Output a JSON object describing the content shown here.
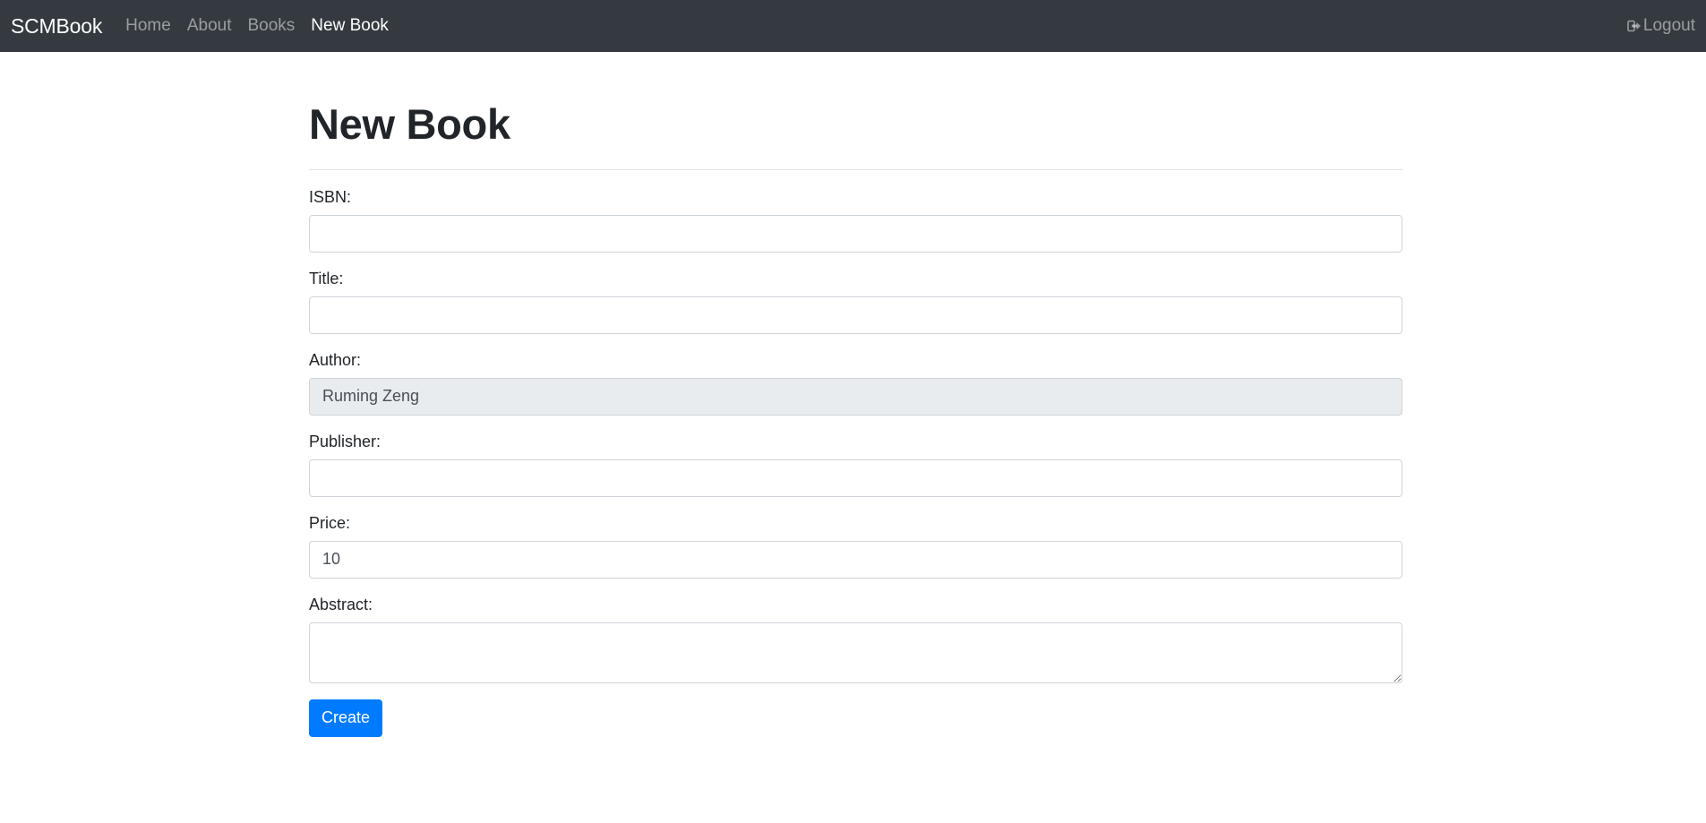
{
  "navbar": {
    "brand": "SCMBook",
    "links": [
      {
        "label": "Home"
      },
      {
        "label": "About"
      },
      {
        "label": "Books"
      },
      {
        "label": "New Book"
      }
    ],
    "logout_label": "Logout"
  },
  "page": {
    "title": "New Book"
  },
  "form": {
    "isbn": {
      "label": "ISBN:",
      "value": ""
    },
    "title": {
      "label": "Title:",
      "value": ""
    },
    "author": {
      "label": "Author:",
      "value": "Ruming Zeng"
    },
    "publisher": {
      "label": "Publisher:",
      "value": ""
    },
    "price": {
      "label": "Price:",
      "value": "10"
    },
    "abstract": {
      "label": "Abstract:",
      "value": ""
    },
    "submit_label": "Create"
  },
  "colors": {
    "navbar_bg": "#343a40",
    "primary": "#007bff",
    "readonly_bg": "#e9ecef"
  },
  "icons": {
    "logout": "sign-out-icon"
  }
}
